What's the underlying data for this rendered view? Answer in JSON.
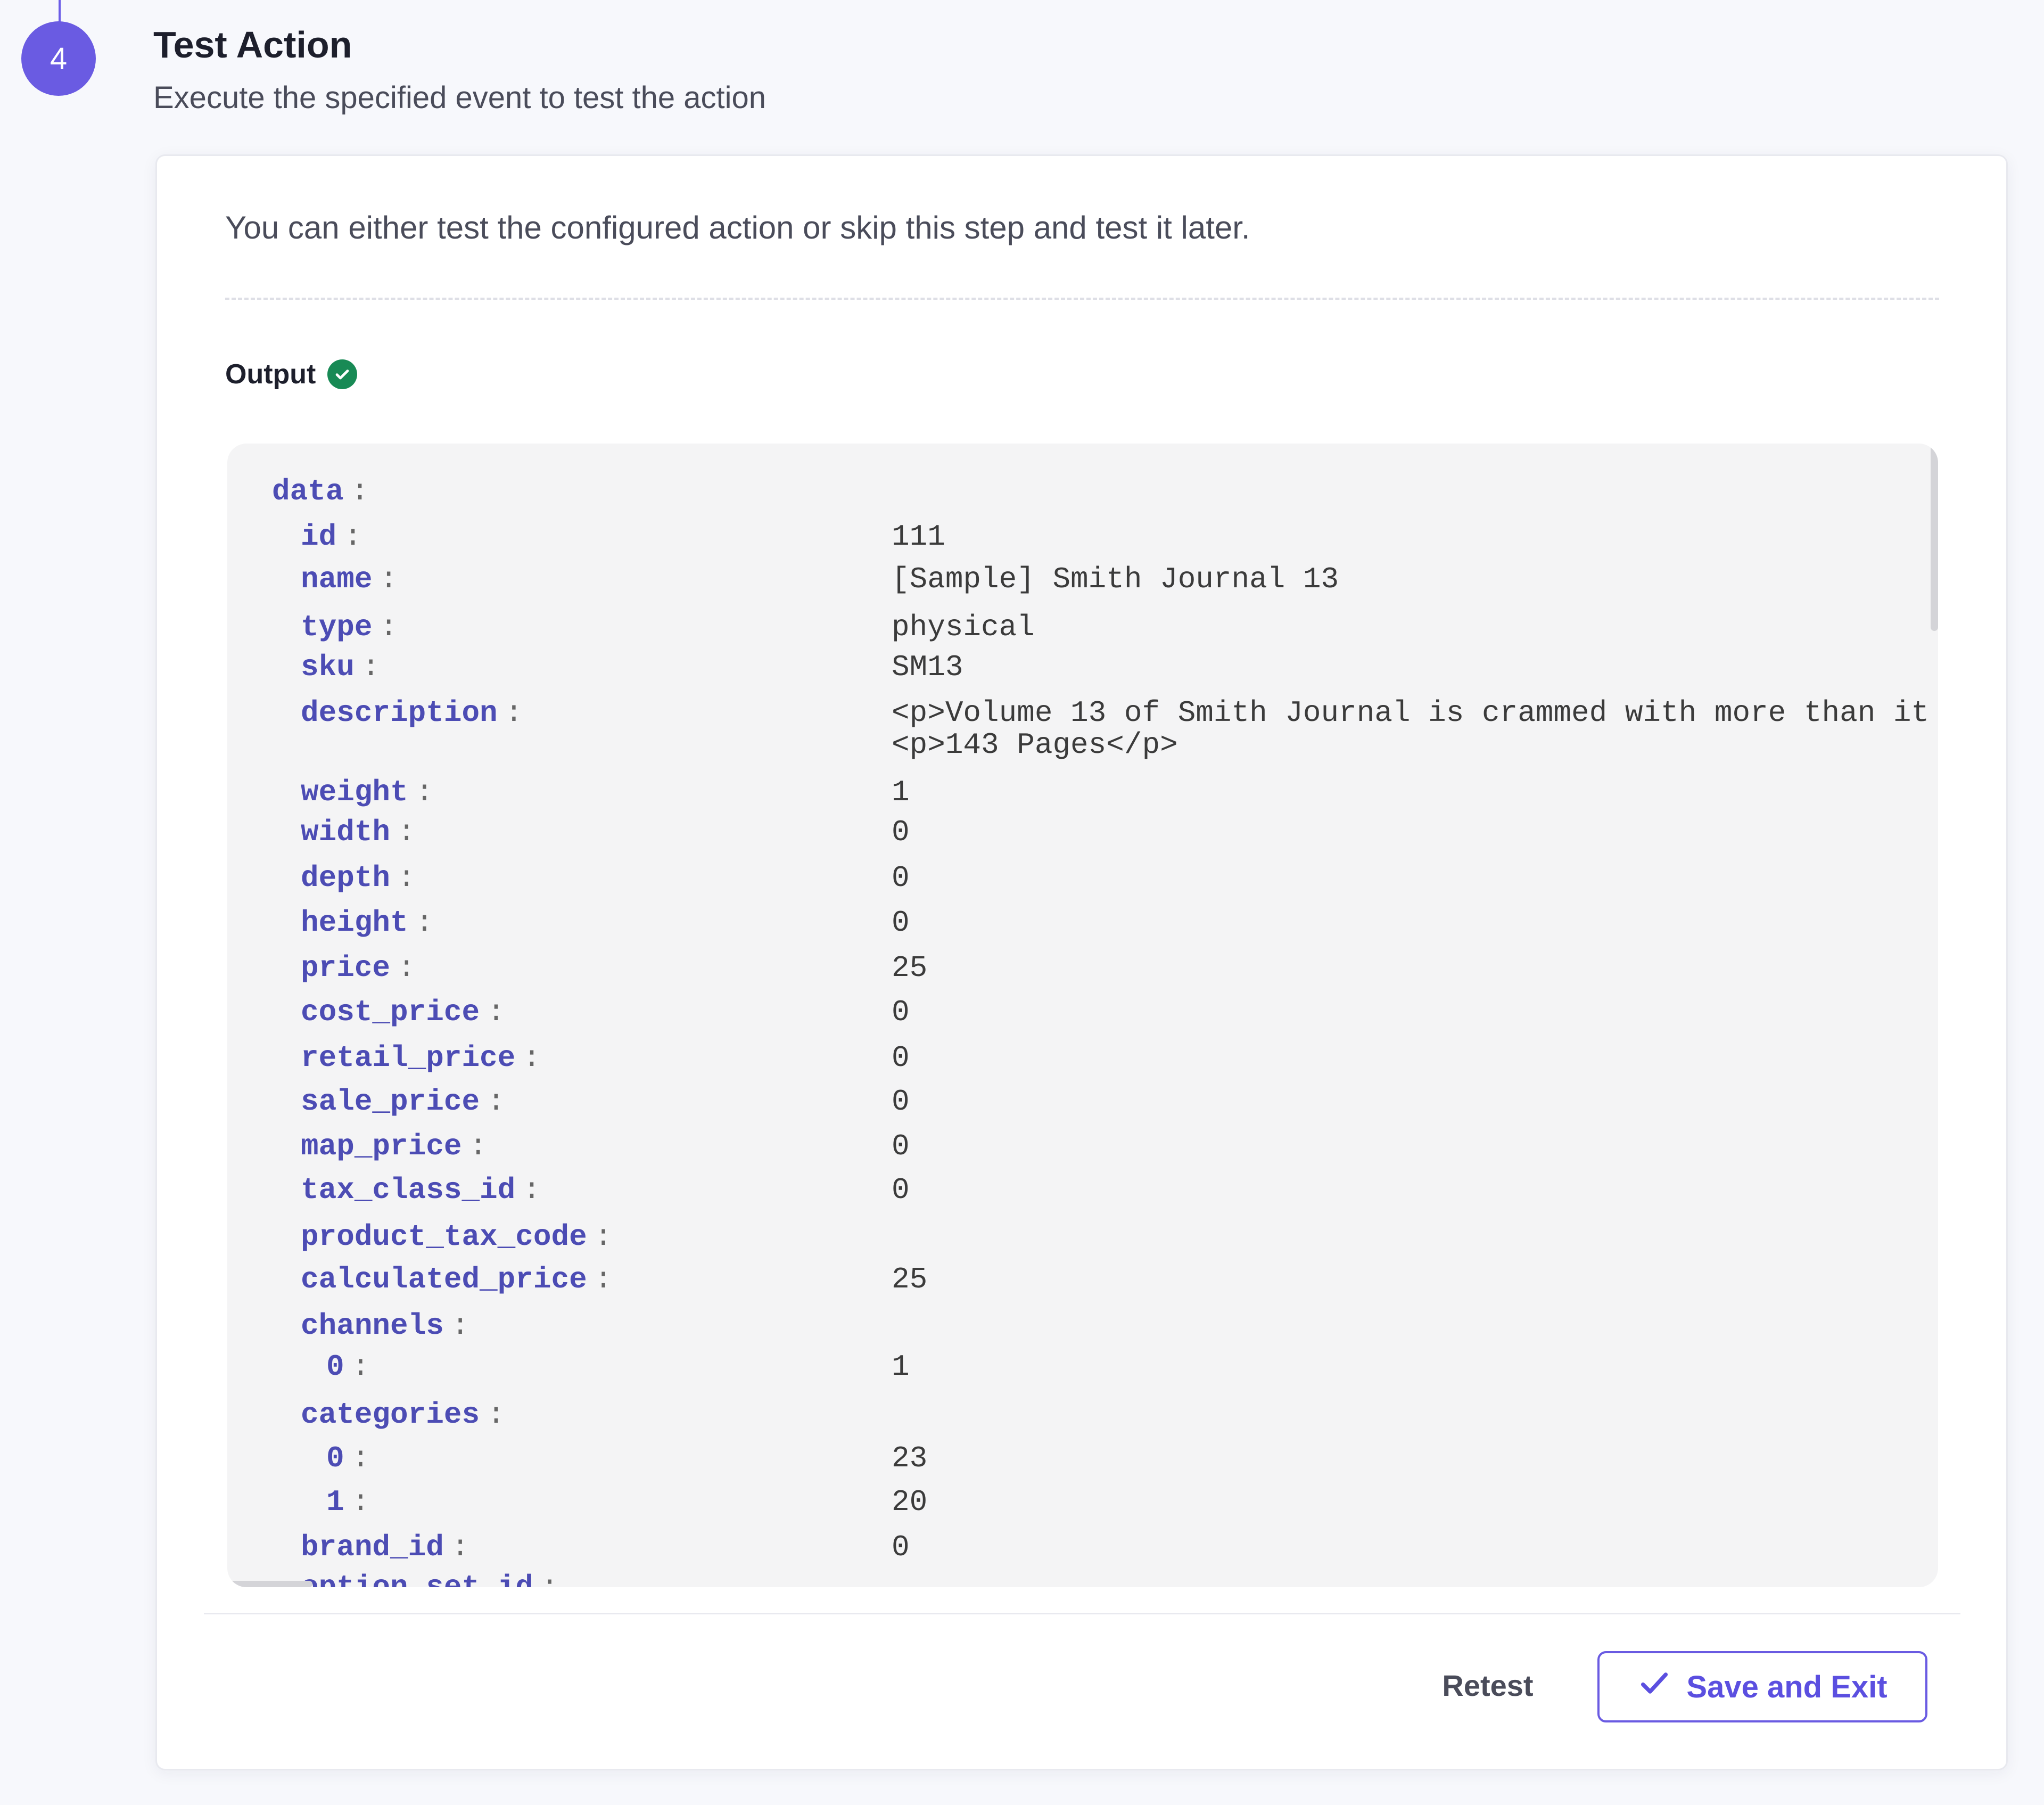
{
  "step": {
    "number": "4",
    "title": "Test Action",
    "subtitle": "Execute the specified event to test the action"
  },
  "card": {
    "intro": "You can either test the configured action or skip this step and test it later.",
    "output_label": "Output",
    "output_rows": [
      {
        "key": "data",
        "level": 0,
        "value": ""
      },
      {
        "key": "id",
        "level": 1,
        "value": "111"
      },
      {
        "key": "name",
        "level": 1,
        "value": "[Sample] Smith Journal 13"
      },
      {
        "key": "type",
        "level": 1,
        "value": "physical"
      },
      {
        "key": "sku",
        "level": 1,
        "value": "SM13"
      },
      {
        "key": "description",
        "level": 1,
        "value": "<p>Volume 13 of Smith Journal is crammed with more than it\n<p>143 Pages</p>"
      },
      {
        "key": "weight",
        "level": 1,
        "value": "1"
      },
      {
        "key": "width",
        "level": 1,
        "value": "0"
      },
      {
        "key": "depth",
        "level": 1,
        "value": "0"
      },
      {
        "key": "height",
        "level": 1,
        "value": "0"
      },
      {
        "key": "price",
        "level": 1,
        "value": "25"
      },
      {
        "key": "cost_price",
        "level": 1,
        "value": "0"
      },
      {
        "key": "retail_price",
        "level": 1,
        "value": "0"
      },
      {
        "key": "sale_price",
        "level": 1,
        "value": "0"
      },
      {
        "key": "map_price",
        "level": 1,
        "value": "0"
      },
      {
        "key": "tax_class_id",
        "level": 1,
        "value": "0"
      },
      {
        "key": "product_tax_code",
        "level": 1,
        "value": ""
      },
      {
        "key": "calculated_price",
        "level": 1,
        "value": "25"
      },
      {
        "key": "channels",
        "level": 1,
        "value": ""
      },
      {
        "key": "0",
        "level": 2,
        "value": "1"
      },
      {
        "key": "categories",
        "level": 1,
        "value": ""
      },
      {
        "key": "0",
        "level": 2,
        "value": "23"
      },
      {
        "key": "1",
        "level": 2,
        "value": "20"
      },
      {
        "key": "brand_id",
        "level": 1,
        "value": "0"
      },
      {
        "key": "option_set_id",
        "level": 1,
        "value": ""
      }
    ],
    "retest_label": "Retest",
    "save_label": "Save and Exit"
  },
  "colors": {
    "accent": "#6a5be2",
    "key_text": "#4c4cb4",
    "success": "#188a55"
  },
  "icons": {
    "output_status": "check-circle-icon",
    "save": "check-icon"
  }
}
